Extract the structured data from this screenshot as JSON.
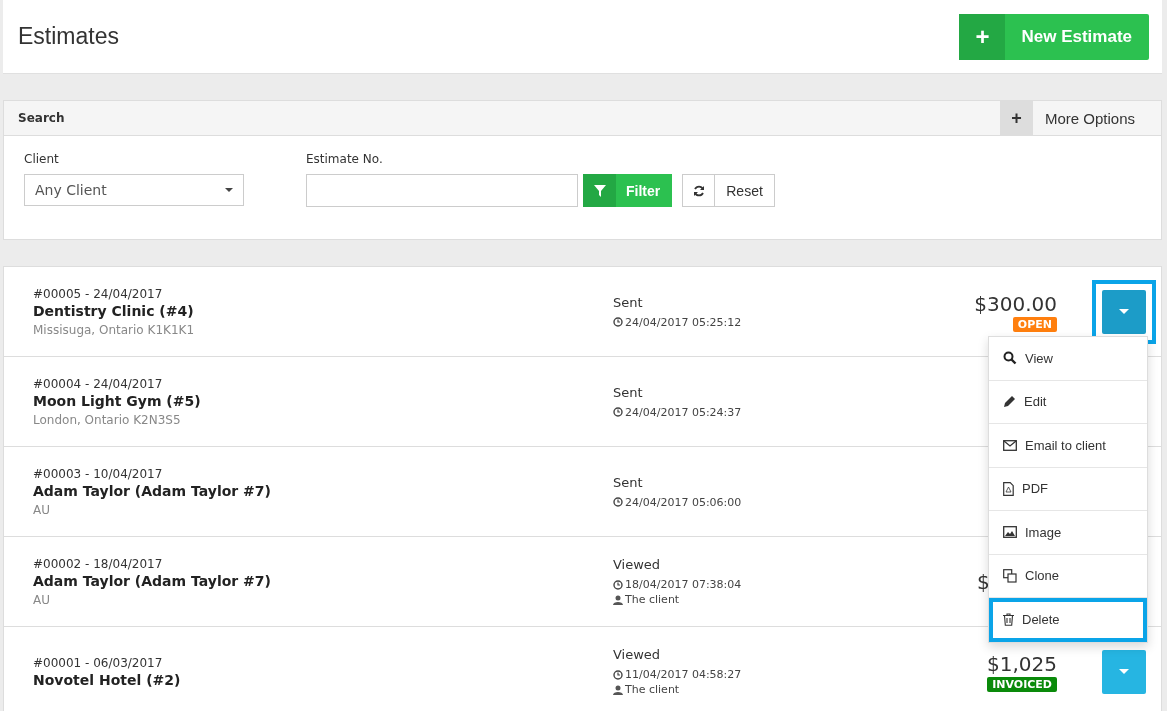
{
  "header": {
    "title": "Estimates",
    "new_button": "New Estimate",
    "new_icon": "+"
  },
  "search": {
    "title": "Search",
    "more_icon": "+",
    "more_label": "More Options",
    "client_label": "Client",
    "client_value": "Any Client",
    "number_label": "Estimate No.",
    "filter_button": "Filter",
    "reset_button": "Reset"
  },
  "estimates": [
    {
      "number": "#00005 - 24/04/2017",
      "client": "Dentistry Clinic (#4)",
      "address": "Missisuga, Ontario K1K1K1",
      "status": "Sent",
      "time": "24/04/2017 05:25:12",
      "amount": "$300.00",
      "badge": {
        "label": "OPEN",
        "color": "#ff7f0e"
      },
      "menu_button": true,
      "highlighted": true
    },
    {
      "number": "#00004 - 24/04/2017",
      "client": "Moon Light Gym (#5)",
      "address": "London, Ontario K2N3S5",
      "status": "Sent",
      "time": "24/04/2017 05:24:37"
    },
    {
      "number": "#00003 - 10/04/2017",
      "client": "Adam Taylor (Adam Taylor #7)",
      "address": "AU",
      "status": "Sent",
      "time": "24/04/2017 05:06:00"
    },
    {
      "number": "#00002 - 18/04/2017",
      "client": "Adam Taylor (Adam Taylor #7)",
      "address": "AU",
      "status": "Viewed",
      "time": "18/04/2017 07:38:04",
      "viewer": "The client",
      "amount": "$"
    },
    {
      "number": "#00001 - 06/03/2017",
      "client": "Novotel Hotel (#2)",
      "status": "Viewed",
      "time": "11/04/2017 04:58:27",
      "viewer": "The client",
      "amount": "$1,025",
      "badge": {
        "label": "INVOICED",
        "color": "#0a8a0a"
      },
      "menu_button": true,
      "highlighted": false
    }
  ],
  "menu": [
    {
      "kind": "view",
      "label": "View",
      "highlighted": false
    },
    {
      "kind": "edit",
      "label": "Edit",
      "highlighted": false
    },
    {
      "kind": "email",
      "label": "Email to client",
      "highlighted": false
    },
    {
      "kind": "pdf",
      "label": "PDF",
      "highlighted": false
    },
    {
      "kind": "image",
      "label": "Image",
      "highlighted": false
    },
    {
      "kind": "clone",
      "label": "Clone",
      "highlighted": false
    },
    {
      "kind": "delete",
      "label": "Delete",
      "highlighted": true
    }
  ]
}
